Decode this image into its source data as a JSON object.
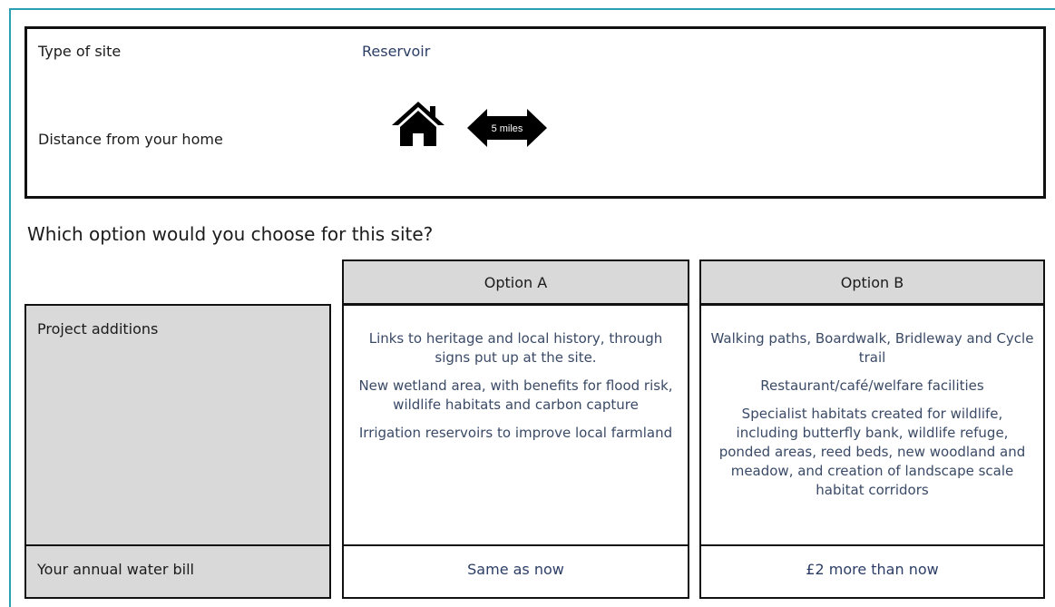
{
  "site": {
    "type_label": "Type of site",
    "type_value": "Reservoir",
    "distance_label": "Distance from your home",
    "distance_value": "5 miles"
  },
  "question": "Which option would you choose for this site?",
  "options": [
    {
      "header": "Option A",
      "additions": [
        "Links to heritage and local history, through signs put up at the site.",
        "New wetland area, with benefits for flood risk, wildlife habitats and carbon capture",
        "Irrigation reservoirs to improve local farmland"
      ],
      "bill": "Same as now"
    },
    {
      "header": "Option B",
      "additions": [
        "Walking paths, Boardwalk, Bridleway and Cycle trail",
        "Restaurant/café/welfare facilities",
        "Specialist habitats created for wildlife, including butterfly bank, wildlife refuge, ponded areas, reed beds, new woodland and meadow, and creation of landscape scale habitat corridors"
      ],
      "bill": "£2 more than now"
    }
  ],
  "rows": {
    "additions_label": "Project additions",
    "bill_label": "Your annual water bill"
  },
  "icons": {
    "home": "house-icon",
    "distance": "double-arrow-icon"
  },
  "colors": {
    "frame": "#2b9fb3",
    "header_fill": "#d9d9d9"
  }
}
